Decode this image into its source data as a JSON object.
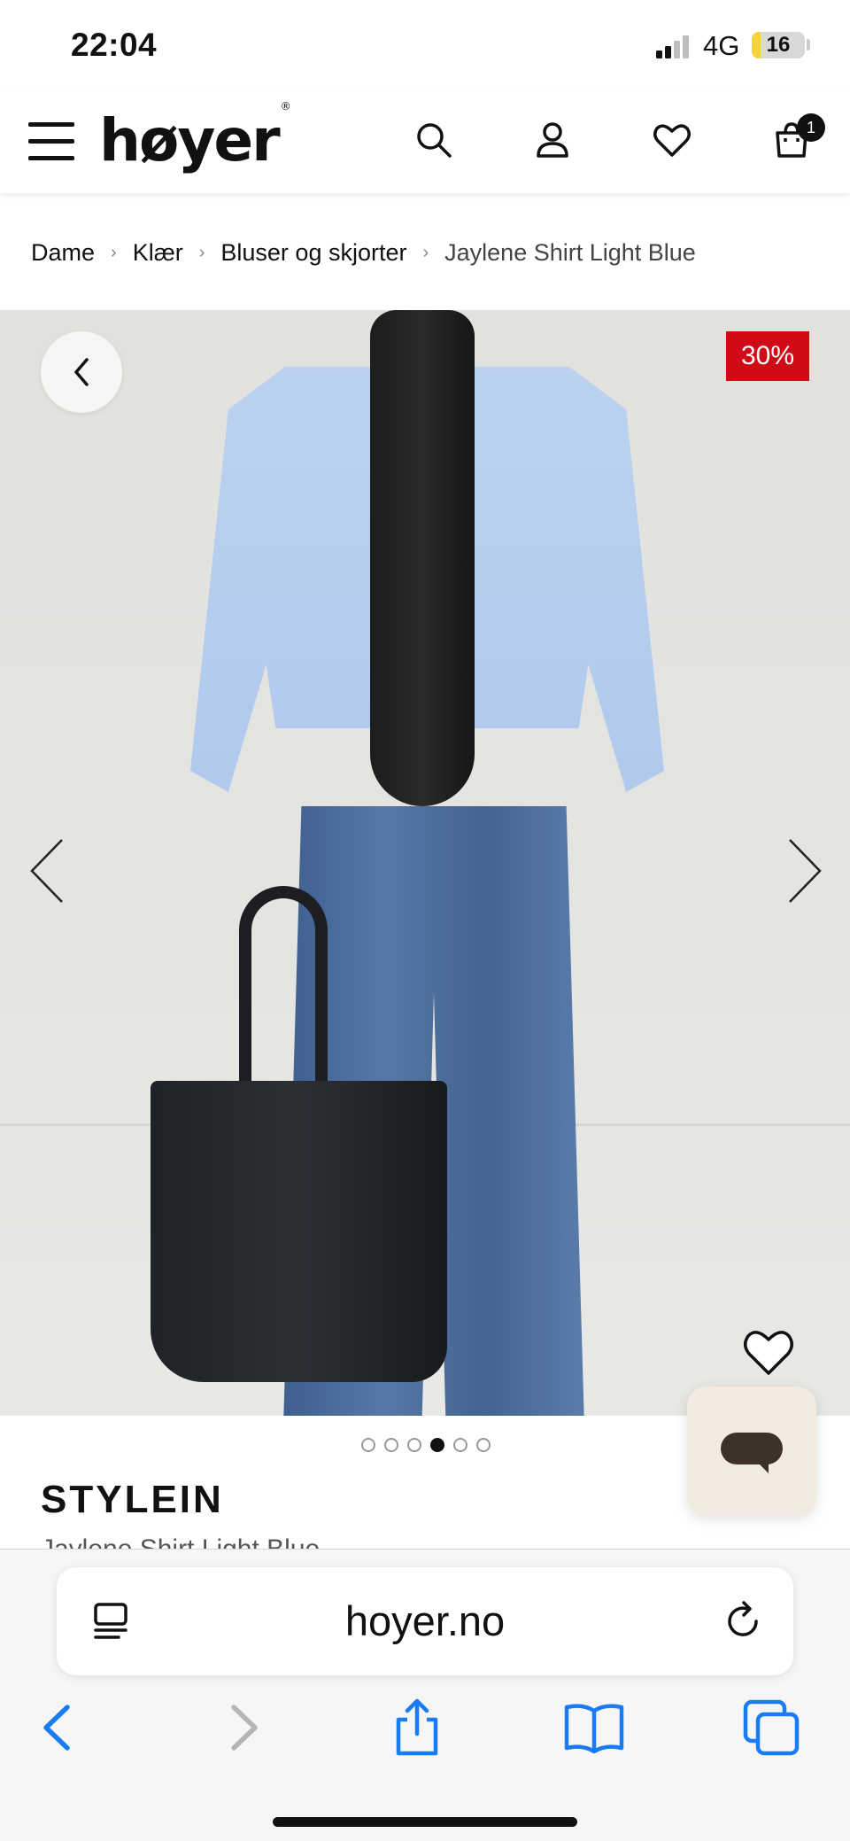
{
  "status_bar": {
    "time": "22:04",
    "network": "4G",
    "battery_level": "16",
    "battery_fraction": 0.16,
    "battery_color": "#f5d33a"
  },
  "header": {
    "logo": "høyer",
    "logo_mark": "®",
    "icons": [
      "menu-icon",
      "search-icon",
      "account-icon",
      "wishlist-icon",
      "cart-icon"
    ],
    "cart_count": "1"
  },
  "breadcrumb": {
    "items": [
      "Dame",
      "Klær",
      "Bluser og skjorter"
    ],
    "current": "Jaylene Shirt Light Blue",
    "separator": "›"
  },
  "product": {
    "discount": "30%",
    "discount_color": "#d10b16",
    "image_count": 6,
    "active_image": 4,
    "brand": "STYLEIN",
    "name": "Jaylene Shirt Light Blue"
  },
  "browser": {
    "url": "hoyer.no",
    "accent_color": "#1a7cf2",
    "toolbar_icons": [
      "back-icon",
      "forward-icon",
      "share-icon",
      "bookmarks-icon",
      "tabs-icon"
    ]
  }
}
